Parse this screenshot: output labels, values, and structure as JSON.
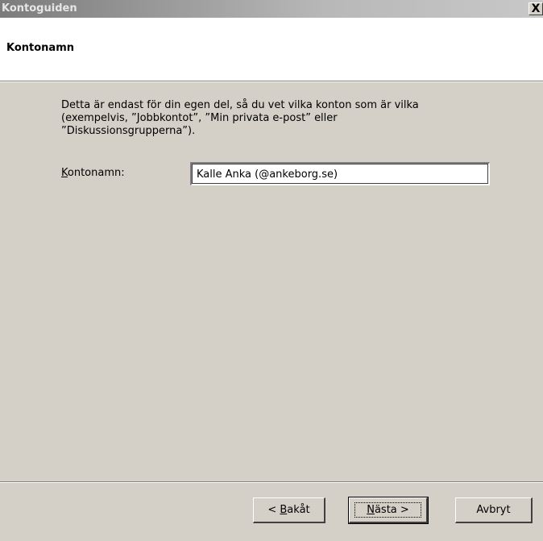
{
  "window": {
    "title": "Kontoguiden",
    "close_glyph": "X"
  },
  "header": {
    "title": "Kontonamn"
  },
  "main": {
    "description_lines": [
      "Detta är endast för din egen del, så du vet vilka konton som är vilka",
      "(exempelvis, ”Jobbkontot”, ”Min privata e-post” eller",
      "”Diskussionsgrupperna”)."
    ],
    "account_name_label_mnemonic": "K",
    "account_name_label_rest": "ontonamn:",
    "account_name_value": "Kalle Anka (@ankeborg.se)"
  },
  "buttons": {
    "back_prefix": "< ",
    "back_mnemonic": "B",
    "back_rest": "akåt",
    "next_mnemonic": "N",
    "next_rest": "ästa >",
    "cancel": "Avbryt"
  },
  "colors": {
    "dialog_bg": "#d4d0c8",
    "header_bg": "#ffffff",
    "title_text": "#e6e6e6"
  },
  "icons": {
    "close": "close-icon"
  }
}
